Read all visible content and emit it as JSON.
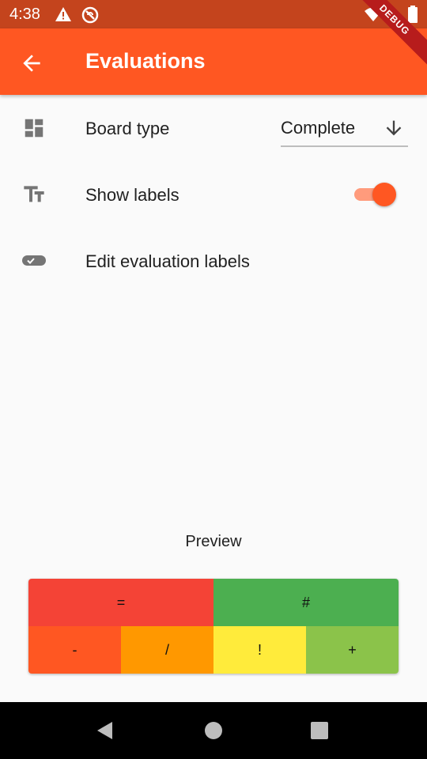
{
  "status_bar": {
    "time": "4:38"
  },
  "debug_ribbon": "DEBUG",
  "app_bar": {
    "title": "Evaluations"
  },
  "settings": {
    "board_type": {
      "label": "Board type",
      "value": "Complete"
    },
    "show_labels": {
      "label": "Show labels",
      "enabled": true
    },
    "edit_labels": {
      "label": "Edit evaluation labels"
    }
  },
  "preview": {
    "title": "Preview",
    "top_row": [
      {
        "label": "=",
        "color": "#f44336"
      },
      {
        "label": "#",
        "color": "#4caf50"
      }
    ],
    "bottom_row": [
      {
        "label": "-",
        "color": "#ff5722"
      },
      {
        "label": "/",
        "color": "#ff9800"
      },
      {
        "label": "!",
        "color": "#ffeb3b"
      },
      {
        "label": "+",
        "color": "#8bc34a"
      }
    ]
  },
  "colors": {
    "primary": "#ff5722",
    "status_bar": "#c4441d"
  }
}
